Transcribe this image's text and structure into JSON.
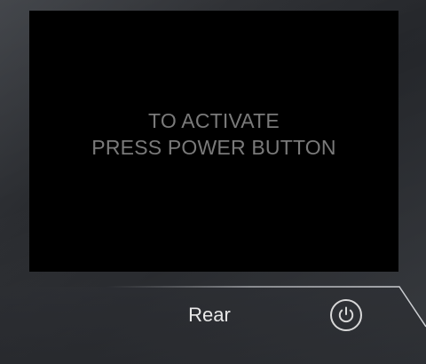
{
  "screen": {
    "message_line1": "TO ACTIVATE",
    "message_line2": "PRESS POWER BUTTON"
  },
  "tab": {
    "label": "Rear"
  },
  "controls": {
    "power_icon": "power-icon"
  },
  "colors": {
    "screen_background": "#000000",
    "message_text": "#7a7a7a",
    "label_text": "#e8e8e8",
    "icon_stroke": "#d8d8d8",
    "panel": "#2a2c30"
  }
}
